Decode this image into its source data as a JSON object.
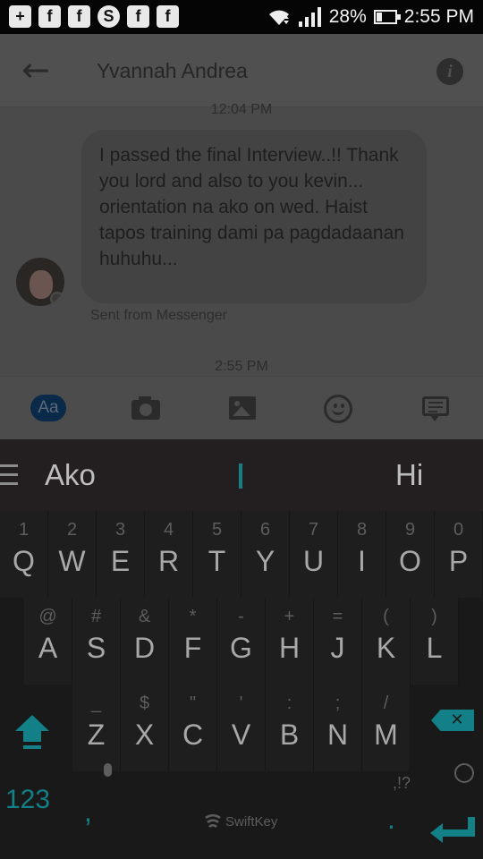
{
  "status_bar": {
    "notifications": [
      "+",
      "f",
      "f",
      "S",
      "f",
      "f"
    ],
    "battery_percent": "28%",
    "battery_level": 0.28,
    "time": "2:55 PM"
  },
  "header": {
    "title": "Yvannah Andrea",
    "info_glyph": "i"
  },
  "conversation": {
    "timestamp_top": "12:04 PM",
    "message_text": "I passed the final Interview..!! Thank you lord and also to you kevin... orientation na ako on wed. Haist tapos training dami pa pagdadaanan huhuhu...",
    "message_footer": "Sent from Messenger",
    "timestamp_bottom": "2:55 PM"
  },
  "composer": {
    "text_button_label": "Aa",
    "icons": [
      "camera-icon",
      "image-icon",
      "emoji-icon",
      "sticker-icon"
    ]
  },
  "keyboard": {
    "suggestions": [
      "Ako",
      "I",
      "Hi"
    ],
    "row1": [
      {
        "pri": "Q",
        "sec": "1"
      },
      {
        "pri": "W",
        "sec": "2"
      },
      {
        "pri": "E",
        "sec": "3"
      },
      {
        "pri": "R",
        "sec": "4"
      },
      {
        "pri": "T",
        "sec": "5"
      },
      {
        "pri": "Y",
        "sec": "6"
      },
      {
        "pri": "U",
        "sec": "7"
      },
      {
        "pri": "I",
        "sec": "8"
      },
      {
        "pri": "O",
        "sec": "9"
      },
      {
        "pri": "P",
        "sec": "0"
      }
    ],
    "row2": [
      {
        "pri": "A",
        "sec": "@"
      },
      {
        "pri": "S",
        "sec": "#"
      },
      {
        "pri": "D",
        "sec": "&"
      },
      {
        "pri": "F",
        "sec": "*"
      },
      {
        "pri": "G",
        "sec": "-"
      },
      {
        "pri": "H",
        "sec": "+"
      },
      {
        "pri": "J",
        "sec": "="
      },
      {
        "pri": "K",
        "sec": "("
      },
      {
        "pri": "L",
        "sec": ")"
      }
    ],
    "row3": [
      {
        "pri": "Z",
        "sec": "_"
      },
      {
        "pri": "X",
        "sec": "$"
      },
      {
        "pri": "C",
        "sec": "\""
      },
      {
        "pri": "V",
        "sec": "'"
      },
      {
        "pri": "B",
        "sec": ":"
      },
      {
        "pri": "N",
        "sec": ";"
      },
      {
        "pri": "M",
        "sec": "/"
      }
    ],
    "numbers_label": "123",
    "comma": ",",
    "period": ".",
    "punct_label": ",!?",
    "brand": "SwiftKey",
    "accent_color": "#137f86"
  }
}
